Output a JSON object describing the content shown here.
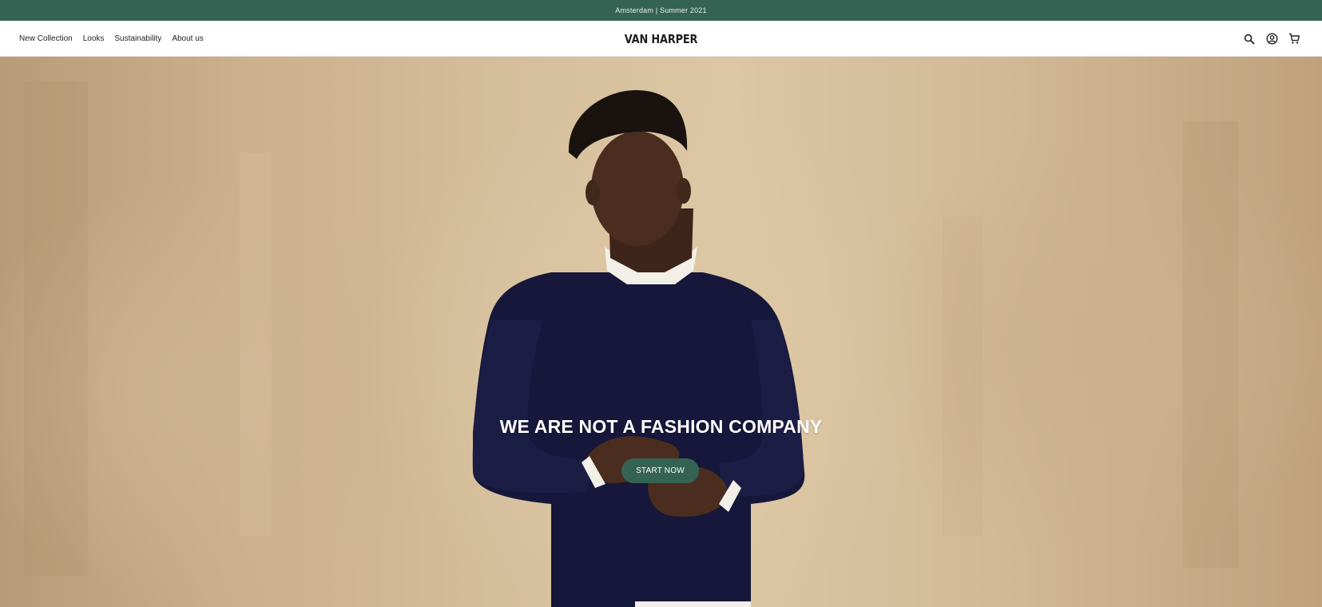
{
  "announcement": {
    "text": "Amsterdam | Summer 2021"
  },
  "header": {
    "nav": [
      {
        "label": "New Collection"
      },
      {
        "label": "Looks"
      },
      {
        "label": "Sustainability"
      },
      {
        "label": "About us"
      }
    ],
    "logo": "VAN HARPER",
    "icons": [
      "search-icon",
      "account-icon",
      "cart-icon"
    ]
  },
  "hero": {
    "title": "WE ARE NOT A FASHION COMPANY",
    "cta_label": "START NOW"
  },
  "colors": {
    "brand_green": "#356353",
    "background_beige": "#d6bf9c",
    "sweater_navy": "#16173a"
  }
}
